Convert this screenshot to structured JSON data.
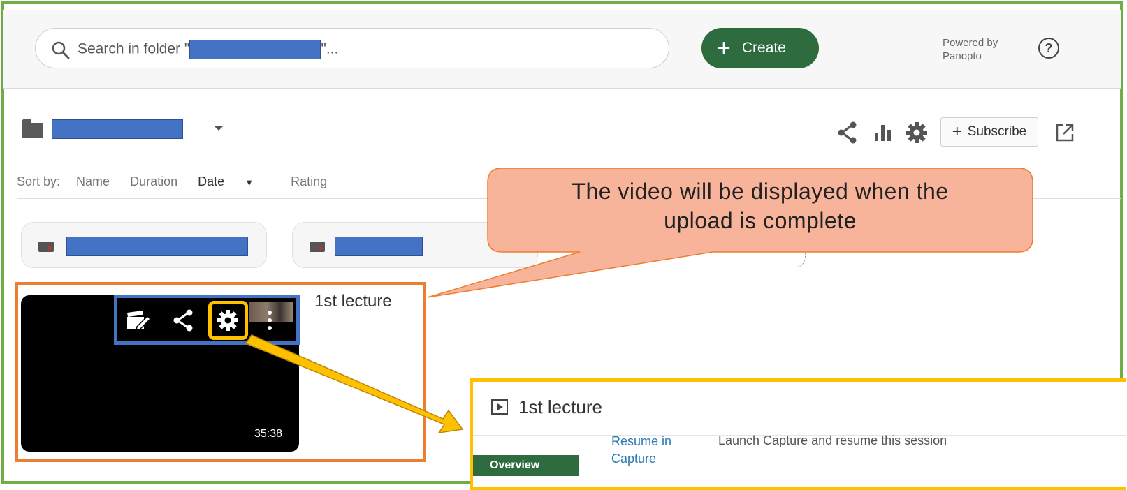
{
  "search": {
    "text_prefix": "Search in folder \"",
    "text_suffix": "\"..."
  },
  "header": {
    "create_label": "Create",
    "powered_by_line1": "Powered by",
    "powered_by_line2": "Panopto",
    "help_glyph": "?"
  },
  "toolbar": {
    "subscribe_label": "Subscribe"
  },
  "sort": {
    "label": "Sort by:",
    "options": [
      "Name",
      "Duration",
      "Date",
      "Rating"
    ],
    "active": "Date"
  },
  "video": {
    "title": "1st lecture",
    "duration": "35:38"
  },
  "callout": {
    "line1": "The video will be displayed when the",
    "line2": "upload is complete"
  },
  "panel": {
    "title": "1st lecture",
    "tab_overview": "Overview",
    "resume_line1": "Resume in",
    "resume_line2": "Capture",
    "resume_desc": "Launch Capture and resume this session"
  },
  "colors": {
    "frame": "#70ad47",
    "create_button": "#2e6b3f",
    "redaction": "#4472c4",
    "video_highlight": "#ed7d31",
    "action_highlight": "#4472c4",
    "settings_highlight": "#ffc000",
    "callout_fill": "#f7b49a",
    "link": "#2b7ab3"
  },
  "icons": [
    "search-icon",
    "plus-icon",
    "help-icon",
    "folder-icon",
    "chevron-down-icon",
    "share-icon",
    "stats-icon",
    "gear-icon",
    "open-external-icon",
    "edit-video-icon",
    "more-icon",
    "play-icon",
    "sort-down-icon"
  ]
}
